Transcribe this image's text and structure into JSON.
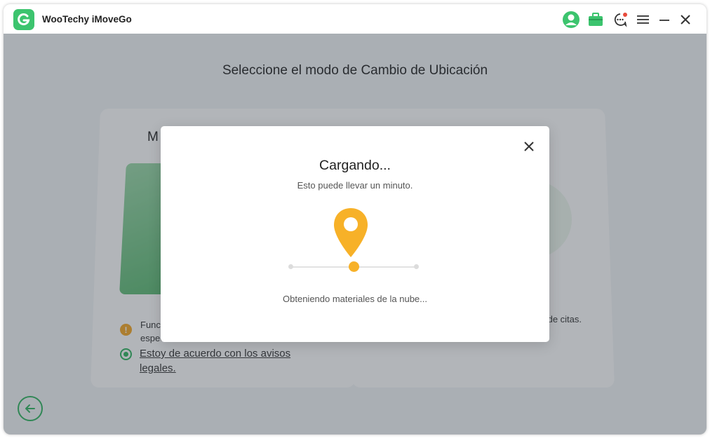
{
  "app": {
    "title": "WooTechy iMoveGo"
  },
  "titlebar_icons": [
    "user-avatar-icon",
    "toolbox-icon",
    "feedback-chat-icon",
    "menu-icon",
    "minimize-icon",
    "close-icon"
  ],
  "page": {
    "title": "Seleccione el modo de Cambio de Ubicación"
  },
  "left_card": {
    "heading_visible": "M",
    "warning_text": "Funciones especiales",
    "agree_text": "Estoy de acuerdo con los avisos legales."
  },
  "right_card": {
    "text": "ciones sociales y de citas."
  },
  "modal": {
    "title": "Cargando...",
    "subtitle": "Esto puede llevar un minuto.",
    "status": "Obteniendo materiales de la nube...",
    "progress_fraction": 0.5
  },
  "colors": {
    "accent": "#2fb560",
    "pin": "#f7b128",
    "overlay": "#343c48",
    "warning": "#f5a623"
  }
}
